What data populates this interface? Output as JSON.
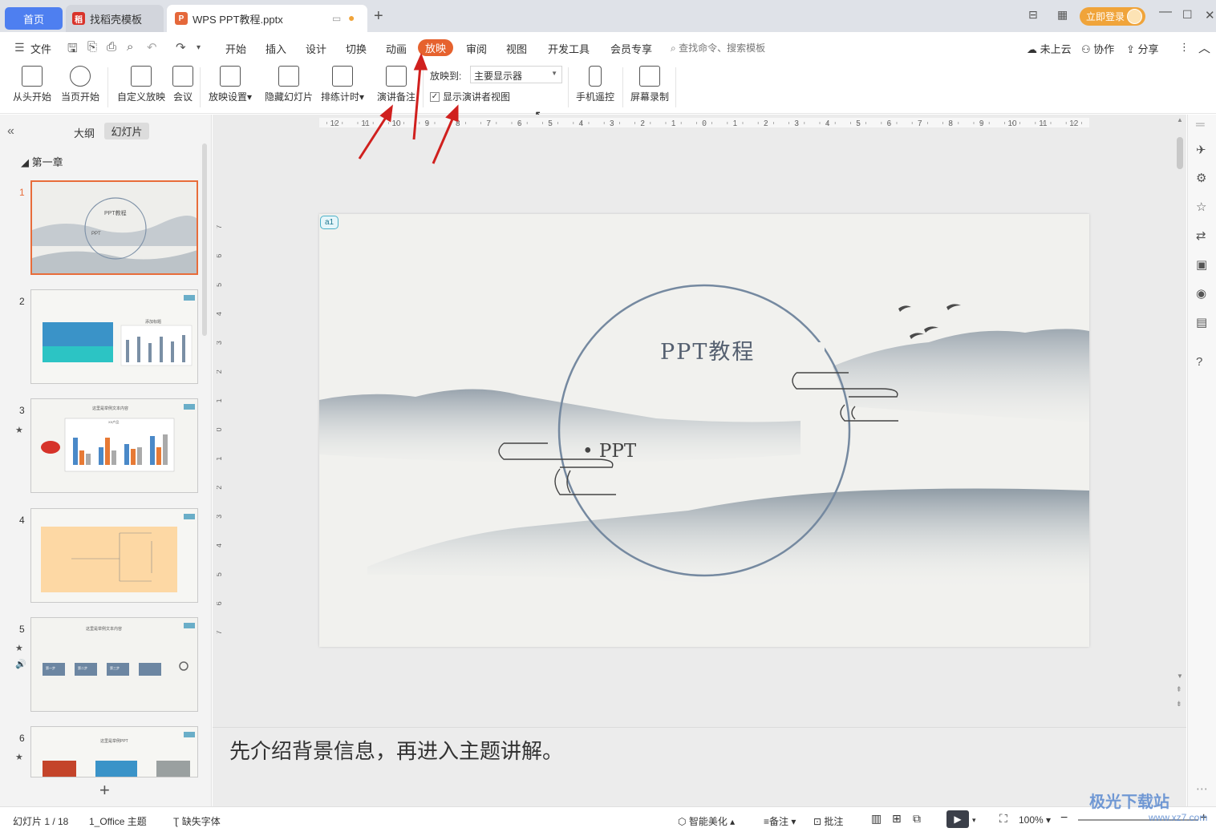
{
  "tabs": {
    "home": "首页",
    "template": "找稻壳模板",
    "document": "WPS PPT教程.pptx"
  },
  "title_bar": {
    "login": "立即登录"
  },
  "menu": {
    "file": "文件",
    "items": [
      "开始",
      "插入",
      "设计",
      "切换",
      "动画",
      "放映",
      "审阅",
      "视图",
      "开发工具",
      "会员专享"
    ],
    "active": "放映",
    "search_placeholder": "查找命令、搜索模板",
    "cloud": "未上云",
    "collaborate": "协作",
    "share": "分享"
  },
  "ribbon": {
    "from_start": "从头开始",
    "from_current": "当页开始",
    "custom_show": "自定义放映",
    "meeting": "会议",
    "show_settings": "放映设置",
    "hide_slide": "隐藏幻灯片",
    "rehearse": "排练计时",
    "speaker_notes": "演讲备注",
    "cast_to_label": "放映到:",
    "cast_to_value": "主要显示器",
    "presenter_view": "显示演讲者视图",
    "presenter_view_checked": true,
    "phone_remote": "手机遥控",
    "screen_record": "屏幕录制"
  },
  "left_panel": {
    "outline": "大纲",
    "slides": "幻灯片",
    "section": "第一章",
    "thumbnails": [
      {
        "num": "1",
        "title": "PPT教程",
        "active": true
      },
      {
        "num": "2",
        "title": "添加标题",
        "active": false
      },
      {
        "num": "3",
        "title": "这里是举例文本内容",
        "active": false
      },
      {
        "num": "4",
        "title": "",
        "active": false
      },
      {
        "num": "5",
        "title": "这里是举例文本内容",
        "active": false
      },
      {
        "num": "6",
        "title": "这里是举例PPT",
        "active": false
      }
    ],
    "thumb3_chart_title": "XX产品",
    "thumb5_steps": [
      "第一步",
      "第二步",
      "第三步"
    ]
  },
  "slide": {
    "title": "PPT教程",
    "bullet": "PPT",
    "comment": "a1"
  },
  "ruler_h_labels": [
    "12",
    "11",
    "10",
    "9",
    "8",
    "7",
    "6",
    "5",
    "4",
    "3",
    "2",
    "1",
    "0",
    "1",
    "2",
    "3",
    "4",
    "5",
    "6",
    "7",
    "8",
    "9",
    "10",
    "11",
    "12"
  ],
  "ruler_v_labels": [
    "7",
    "6",
    "5",
    "4",
    "3",
    "2",
    "1",
    "0",
    "1",
    "2",
    "3",
    "4",
    "5",
    "6",
    "7"
  ],
  "notes": {
    "text": "先介绍背景信息，再进入主题讲解。"
  },
  "status": {
    "slide_count": "幻灯片 1 / 18",
    "theme": "1_Office 主题",
    "missing_font": "缺失字体",
    "beautify": "智能美化",
    "notes": "备注",
    "comment": "批注",
    "zoom": "100%"
  },
  "watermark": {
    "brand": "极光下载站",
    "url": "www.xz7.com"
  },
  "colors": {
    "accent_orange": "#e6622e",
    "home_tab_blue": "#4e7ff0",
    "login_orange": "#f0a43a",
    "arrow_red": "#d0201e"
  }
}
